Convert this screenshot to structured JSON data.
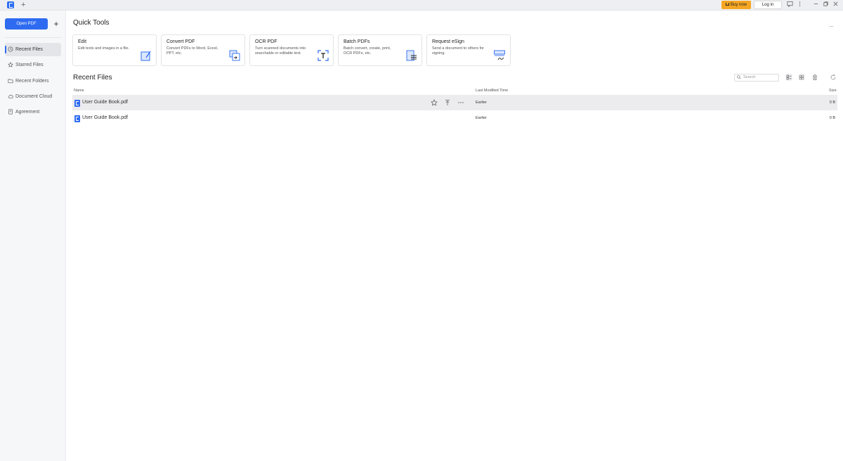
{
  "titlebar": {
    "new_tab": "+",
    "buy_now": "Buy now",
    "log_in": "Log in",
    "icons": [
      "feedback-icon",
      "more-vertical-icon",
      "minimize-icon",
      "restore-icon",
      "close-icon"
    ]
  },
  "sidebar": {
    "open_pdf": "Open PDF",
    "add": "+",
    "items": [
      {
        "label": "Recent Files",
        "icon": "clock-icon",
        "active": true
      },
      {
        "label": "Starred Files",
        "icon": "star-icon"
      },
      {
        "label": "Recent Folders",
        "icon": "folder-icon"
      },
      {
        "label": "Document Cloud",
        "icon": "cloud-icon"
      },
      {
        "label": "Agreement",
        "icon": "document-icon"
      }
    ]
  },
  "main": {
    "quick_tools_title": "Quick Tools",
    "more": "...",
    "tools": [
      {
        "title": "Edit",
        "desc": "Edit texts and images in a file."
      },
      {
        "title": "Convert PDF",
        "desc": "Convert PDFs to Word, Excel, PPT, etc."
      },
      {
        "title": "OCR PDF",
        "desc": "Turn scanned documents into searchable or editable text."
      },
      {
        "title": "Batch PDFs",
        "desc": "Batch convert, create, print, OCR PDFs, etc."
      },
      {
        "title": "Request eSign",
        "desc": "Send a document to others for signing."
      }
    ],
    "recent_title": "Recent Files",
    "search_placeholder": "Search",
    "columns": {
      "name": "Name",
      "modified": "Last Modified Time",
      "size": "Size"
    },
    "files": [
      {
        "name": "User Guide Book.pdf",
        "modified": "Earlier",
        "size": "0 B"
      },
      {
        "name": "User Guide Book.pdf",
        "modified": "Earlier",
        "size": "0 B"
      }
    ]
  },
  "colors": {
    "accent": "#2e6bf0",
    "buy": "#f5a623"
  }
}
